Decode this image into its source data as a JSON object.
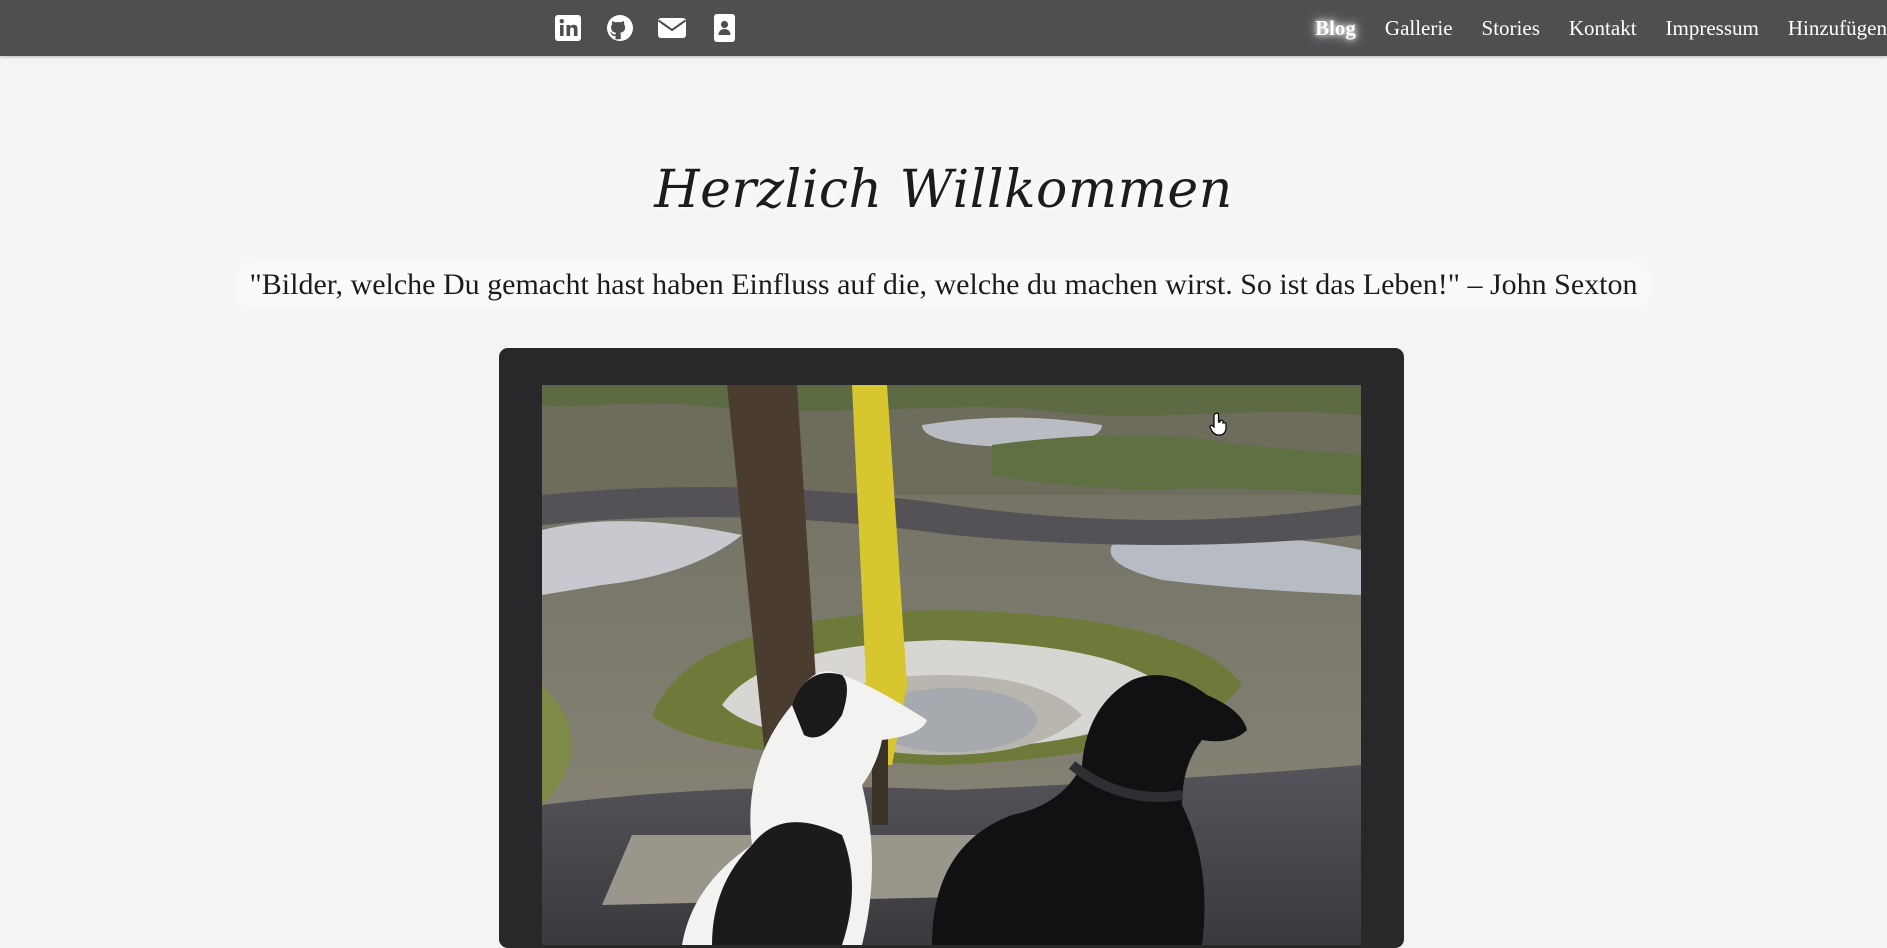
{
  "nav": {
    "social_icons": [
      "linkedin-icon",
      "github-icon",
      "envelope-icon",
      "contact-card-icon"
    ],
    "links": [
      {
        "label": "Blog",
        "active": true
      },
      {
        "label": "Gallerie",
        "active": false
      },
      {
        "label": "Stories",
        "active": false
      },
      {
        "label": "Kontakt",
        "active": false
      },
      {
        "label": "Impressum",
        "active": false
      },
      {
        "label": "Hinzufügen",
        "active": false
      }
    ]
  },
  "main": {
    "title": "Herzlich Willkommen",
    "quote": "\"Bilder, welche Du gemacht hast haben Einfluss auf die, welche du machen wirst. So ist das Leben!\" – John Sexton"
  },
  "colors": {
    "navbar": "#4f4f52",
    "page_background": "#f4f4f6",
    "frame": "#28282b",
    "nav_text": "#ffffff",
    "heading_text": "#1c1c1c"
  }
}
